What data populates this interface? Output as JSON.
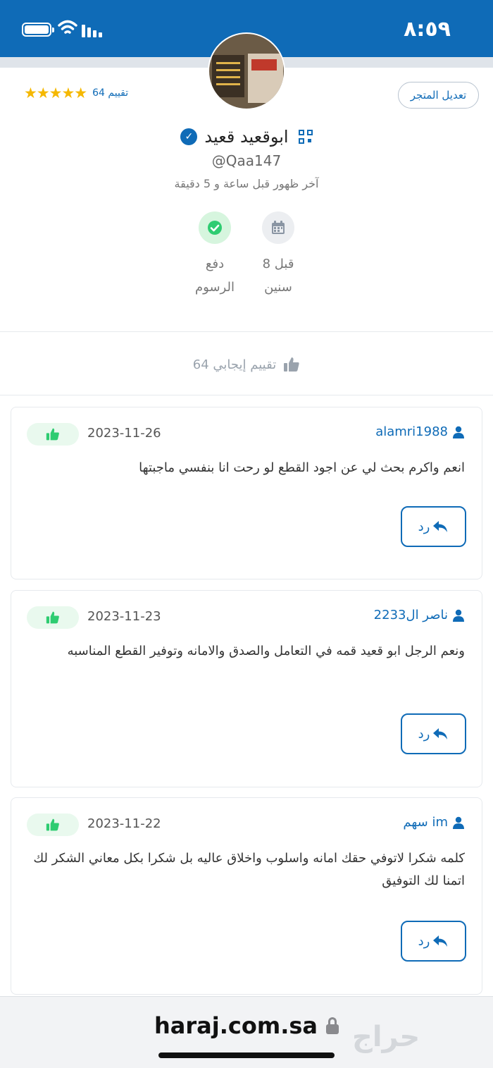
{
  "status_bar": {
    "time": "٨:٥٩",
    "icons": [
      "battery-icon",
      "wifi-icon",
      "signal-icon"
    ]
  },
  "profile": {
    "edit_store_label": "تعديل المتجر",
    "rating_count_label": "64 تقييم",
    "stars": 5,
    "store_name": "ابوقعيد قعيد",
    "handle": "@Qaa147",
    "last_seen": "آخر ظهور قبل ساعة و 5 دقيقة",
    "stats": [
      {
        "icon": "calendar-icon",
        "line1": "قبل 8",
        "line2": "سنين"
      },
      {
        "icon": "verified-check-icon",
        "line1": "دفع",
        "line2": "الرسوم"
      }
    ]
  },
  "summary": {
    "positive_label": "64 تقييم إيجابي"
  },
  "reviews": [
    {
      "user": "alamri1988",
      "date": "2023-11-26",
      "text": "انعم واكرم بحث لي عن اجود القطع لو رحت انا بنفسي ماجبتها",
      "reply_label": "رد"
    },
    {
      "user": "ناصر ال2233",
      "date": "2023-11-23",
      "text": "ونعم الرجل ابو قعيد قمه في التعامل والصدق والامانه وتوفير القطع المناسبه",
      "reply_label": "رد"
    },
    {
      "user": "سهم im",
      "date": "2023-11-22",
      "text": "كلمه شكرا لاتوفي حقك امانه واسلوب واخلاق عاليه بل شكرا بكل معاني الشكر لك اتمنا لك التوفيق",
      "reply_label": "رد"
    }
  ],
  "browser": {
    "url": "haraj.com.sa",
    "watermark": "حراج"
  },
  "colors": {
    "primary": "#0f6bb7",
    "star": "#f5b800",
    "like_bg": "#e9f9ee",
    "like_icon": "#2ecc71"
  }
}
